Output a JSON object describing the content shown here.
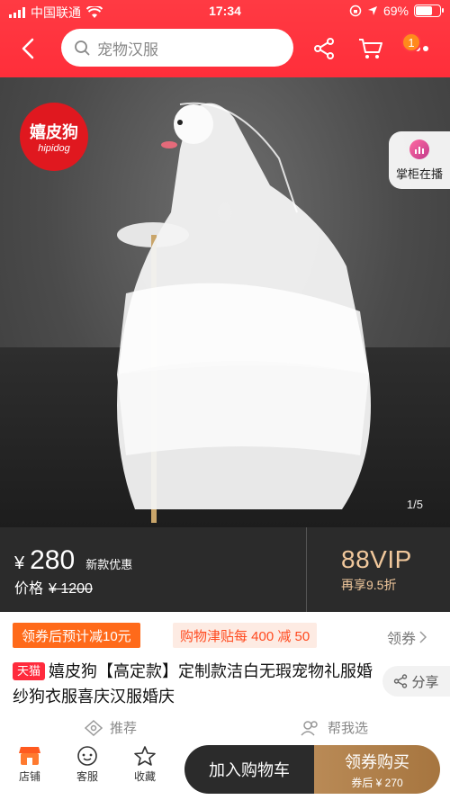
{
  "status_bar": {
    "carrier": "中国联通",
    "time": "17:34",
    "battery_percent": "69%",
    "battery_level": 0.69
  },
  "nav": {
    "search_placeholder": "宠物汉服",
    "cart_badge": "1",
    "icons": [
      "back-arrow-icon",
      "search-icon",
      "share-icon",
      "cart-icon",
      "more-icon"
    ]
  },
  "gallery": {
    "brand_logo_cn": "嬉皮狗",
    "brand_logo_en": "hipidog",
    "live_label": "掌柜在播",
    "counter": "1/5"
  },
  "price": {
    "symbol": "¥",
    "current": "280",
    "promo_tag": "新款优惠",
    "orig_label": "价格",
    "orig_price": "¥ 1200",
    "vip_title": "88VIP",
    "vip_sub": "再享9.5折"
  },
  "promo": {
    "chip1": "领券后预计减10元",
    "chip2": "购物津贴每 400 减 50",
    "coupon_link": "领券"
  },
  "product": {
    "tmall_tag": "天猫",
    "title": "嬉皮狗【高定款】定制款洁白无瑕宠物礼服婚纱狗衣服喜庆汉服婚庆",
    "share_label": "分享"
  },
  "tabs": {
    "recommend": "推荐",
    "help_choose": "帮我选"
  },
  "bottom_bar": {
    "store": "店铺",
    "service": "客服",
    "favorite": "收藏",
    "add_to_cart": "加入购物车",
    "buy_title": "领券购买",
    "buy_sub": "券后 ¥ 270"
  },
  "colors": {
    "brand_red": "#ff3a43",
    "promo_orange": "#ff6a1a",
    "vip_gold": "#f1c89c",
    "buy_gold": "#b98a56"
  }
}
